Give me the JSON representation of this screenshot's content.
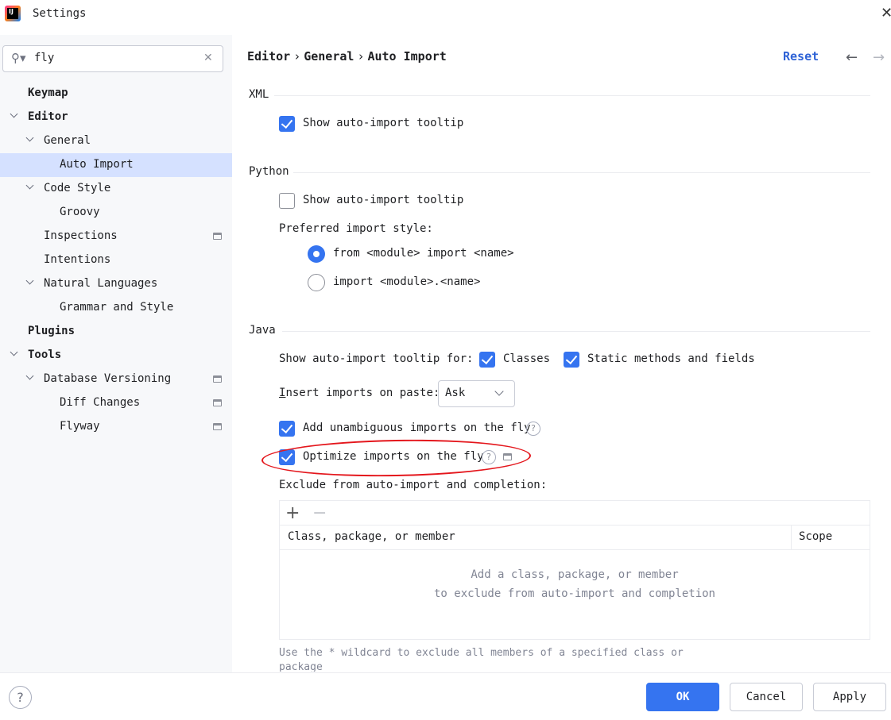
{
  "window": {
    "title": "Settings",
    "close_icon": "close-icon",
    "app_icon": "intellij-idea-icon",
    "app_icon_text": "IJ"
  },
  "search": {
    "value": "fly",
    "icon": "search-icon",
    "clear_icon": "clear-icon"
  },
  "tree": [
    {
      "label": "Keymap",
      "bold": true,
      "level": 0,
      "expanded": null,
      "selected": false,
      "project_scope": false
    },
    {
      "label": "Editor",
      "bold": true,
      "level": 0,
      "expanded": true,
      "selected": false,
      "project_scope": false
    },
    {
      "label": "General",
      "bold": false,
      "level": 1,
      "expanded": true,
      "selected": false,
      "project_scope": false
    },
    {
      "label": "Auto Import",
      "bold": false,
      "level": 2,
      "expanded": null,
      "selected": true,
      "project_scope": false
    },
    {
      "label": "Code Style",
      "bold": false,
      "level": 1,
      "expanded": true,
      "selected": false,
      "project_scope": false
    },
    {
      "label": "Groovy",
      "bold": false,
      "level": 2,
      "expanded": null,
      "selected": false,
      "project_scope": false
    },
    {
      "label": "Inspections",
      "bold": false,
      "level": 1,
      "expanded": null,
      "selected": false,
      "project_scope": true
    },
    {
      "label": "Intentions",
      "bold": false,
      "level": 1,
      "expanded": null,
      "selected": false,
      "project_scope": false
    },
    {
      "label": "Natural Languages",
      "bold": false,
      "level": 1,
      "expanded": true,
      "selected": false,
      "project_scope": false
    },
    {
      "label": "Grammar and Style",
      "bold": false,
      "level": 2,
      "expanded": null,
      "selected": false,
      "project_scope": false
    },
    {
      "label": "Plugins",
      "bold": true,
      "level": 0,
      "expanded": null,
      "selected": false,
      "project_scope": false
    },
    {
      "label": "Tools",
      "bold": true,
      "level": 0,
      "expanded": true,
      "selected": false,
      "project_scope": false
    },
    {
      "label": "Database Versioning",
      "bold": false,
      "level": 1,
      "expanded": true,
      "selected": false,
      "project_scope": true
    },
    {
      "label": "Diff Changes",
      "bold": false,
      "level": 2,
      "expanded": null,
      "selected": false,
      "project_scope": true
    },
    {
      "label": "Flyway",
      "bold": false,
      "level": 2,
      "expanded": null,
      "selected": false,
      "project_scope": true
    }
  ],
  "header": {
    "breadcrumb": [
      "Editor",
      "General",
      "Auto Import"
    ],
    "breadcrumb_sep": "›",
    "reset_label": "Reset",
    "back_icon": "arrow-left-icon",
    "forward_icon": "arrow-right-icon"
  },
  "xml": {
    "title": "XML",
    "show_tooltip": {
      "label": "Show auto-import tooltip",
      "checked": true
    }
  },
  "python": {
    "title": "Python",
    "show_tooltip": {
      "label": "Show auto-import tooltip",
      "checked": false
    },
    "preferred_style_label": "Preferred import style:",
    "style_options": [
      {
        "label": "from <module> import <name>",
        "selected": true
      },
      {
        "label": "import <module>.<name>",
        "selected": false
      }
    ]
  },
  "java": {
    "title": "Java",
    "tooltip_for_label": "Show auto-import tooltip for:",
    "classes": {
      "label": "Classes",
      "checked": true
    },
    "static_methods": {
      "label": "Static methods and fields",
      "checked": true
    },
    "insert_on_paste_mnemonic": "I",
    "insert_on_paste_rest": "nsert imports on paste:",
    "insert_on_paste_value": "Ask",
    "add_unambiguous": {
      "label": "Add unambiguous imports on the fly",
      "checked": true
    },
    "optimize_on_fly": {
      "label": "Optimize imports on the fly",
      "checked": true
    },
    "exclude_label": "Exclude from auto-import and completion:",
    "add_icon": "plus-icon",
    "remove_icon": "minus-icon",
    "columns": [
      "Class, package, or member",
      "Scope"
    ],
    "empty_line1": "Add a class, package, or member",
    "empty_line2": "to exclude from auto-import and completion",
    "hint_line1": "Use the * wildcard to exclude all members of a specified class or",
    "hint_line2": "package"
  },
  "annotation": {
    "color": "#e4161c"
  },
  "footer": {
    "help_icon": "help-icon",
    "ok_label": "OK",
    "cancel_label": "Cancel",
    "apply_label": "Apply"
  },
  "colors": {
    "accent": "#3574f0",
    "selection": "#d5e1ff",
    "link": "#2f63d6"
  }
}
